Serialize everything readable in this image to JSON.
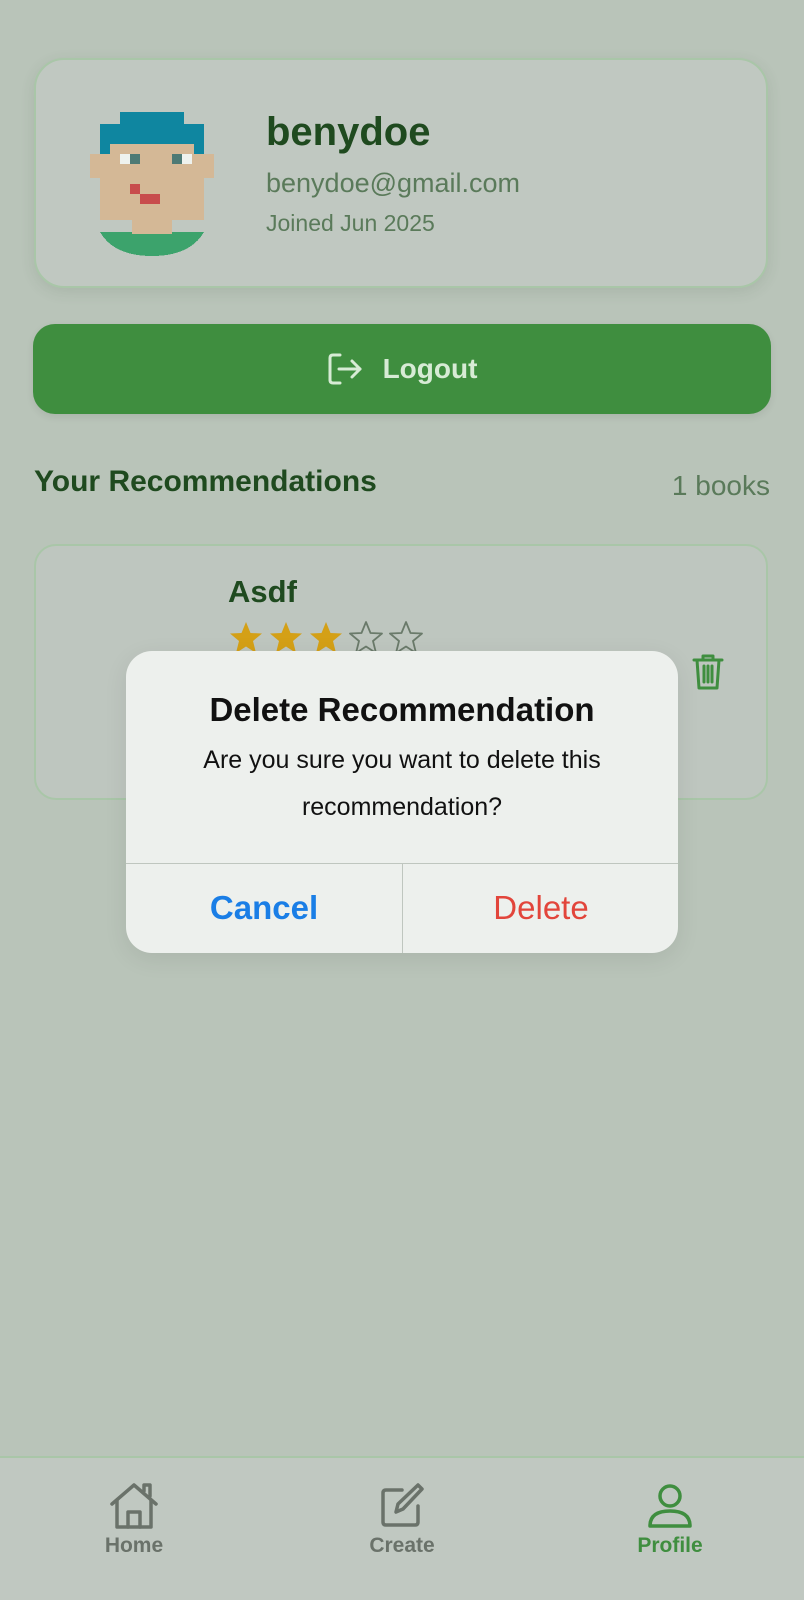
{
  "profile": {
    "username": "benydoe",
    "email": "benydoe@gmail.com",
    "joined": "Joined Jun 2025",
    "avatar_icon": "pixel-avatar"
  },
  "logout": {
    "label": "Logout",
    "icon": "logout-icon"
  },
  "recommendations": {
    "title": "Your Recommendations",
    "count_label": "1 books",
    "items": [
      {
        "title": "Asdf",
        "rating": 3,
        "max_rating": 5
      }
    ]
  },
  "dialog": {
    "title": "Delete Recommendation",
    "message": "Are you sure you want to delete this recommendation?",
    "cancel_label": "Cancel",
    "delete_label": "Delete"
  },
  "tabs": [
    {
      "label": "Home",
      "icon": "home-icon",
      "active": false
    },
    {
      "label": "Create",
      "icon": "create-icon",
      "active": false
    },
    {
      "label": "Profile",
      "icon": "profile-icon",
      "active": true
    }
  ],
  "colors": {
    "primary": "#3f8e3f",
    "star": "#d4a017",
    "cancel": "#1a7ee6",
    "delete": "#e2453b"
  }
}
